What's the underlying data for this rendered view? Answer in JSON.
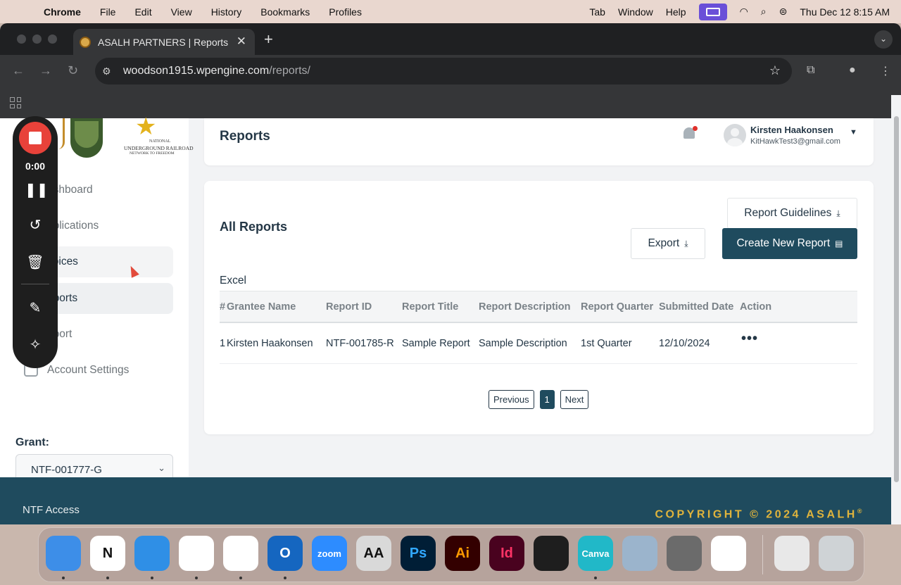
{
  "menubar": {
    "app": "Chrome",
    "items": [
      "File",
      "Edit",
      "View",
      "History",
      "Bookmarks",
      "Profiles"
    ],
    "right_items": [
      "Tab",
      "Window",
      "Help"
    ],
    "datetime": "Thu Dec 12  8:15 AM"
  },
  "browser": {
    "tab_title": "ASALH PARTNERS | Reports",
    "url_host": "woodson1915.wpengine.com",
    "url_path": "/reports/"
  },
  "sidebar": {
    "logos": {
      "nps": "NATIONAL PARK SERVICE",
      "ugrr_1": "NATIONAL",
      "ugrr_2": "UNDERGROUND RAILROAD",
      "ugrr_3": "NETWORK TO FREEDOM"
    },
    "items": [
      {
        "label": "Dashboard",
        "visible": "ashboard"
      },
      {
        "label": "Applications",
        "visible": "pplications"
      },
      {
        "label": "Invoices",
        "visible": "voices"
      },
      {
        "label": "Reports",
        "visible": "eports"
      },
      {
        "label": "Support",
        "visible": "pport"
      },
      {
        "label": "Account Settings",
        "visible": "Account Settings"
      }
    ],
    "grant_label": "Grant:",
    "grant_value": "NTF-001777-G"
  },
  "header": {
    "title": "Reports",
    "user_name": "Kirsten Haakonsen",
    "user_email": "KitHawkTest3@gmail.com"
  },
  "reports": {
    "title": "All Reports",
    "guidelines_label": "Report Guidelines",
    "export_label": "Export",
    "create_label": "Create New Report",
    "excel_label": "Excel",
    "columns": [
      "#",
      "Grantee Name",
      "Report ID",
      "Report Title",
      "Report Description",
      "Report Quarter",
      "Submitted Date",
      "Action"
    ],
    "rows": [
      [
        "1",
        "Kirsten Haakonsen",
        "NTF-001785-R",
        "Sample Report",
        "Sample Description",
        "1st Quarter",
        "12/10/2024",
        "•••"
      ]
    ],
    "pager": {
      "previous": "Previous",
      "current": "1",
      "next": "Next"
    }
  },
  "footer": {
    "link": "NTF Access",
    "copyright": "COPYRIGHT © 2024 ASALH",
    "reg": "®"
  },
  "recorder": {
    "time": "0:00"
  },
  "dock": {
    "apps": [
      {
        "name": "Finder",
        "color": "#3d8ee8",
        "glyph": ""
      },
      {
        "name": "Notion",
        "color": "#ffffff",
        "glyph": "N"
      },
      {
        "name": "Safari",
        "color": "#2f8fe6",
        "glyph": ""
      },
      {
        "name": "Chrome",
        "color": "#ffffff",
        "glyph": ""
      },
      {
        "name": "Slack",
        "color": "#ffffff",
        "glyph": ""
      },
      {
        "name": "Outlook",
        "color": "#1566c0",
        "glyph": "O"
      },
      {
        "name": "Zoom",
        "color": "#2d8cff",
        "glyph": "zoom"
      },
      {
        "name": "Font Book",
        "color": "#d9d9d9",
        "glyph": "AA"
      },
      {
        "name": "Photoshop",
        "color": "#001e36",
        "glyph": "Ps"
      },
      {
        "name": "Illustrator",
        "color": "#330000",
        "glyph": "Ai"
      },
      {
        "name": "InDesign",
        "color": "#49021f",
        "glyph": "Id"
      },
      {
        "name": "Figma",
        "color": "#1e1e1e",
        "glyph": ""
      },
      {
        "name": "Canva",
        "color": "#21b8c8",
        "glyph": "Canva"
      },
      {
        "name": "Preview",
        "color": "#9bb4cc",
        "glyph": ""
      },
      {
        "name": "Calculator",
        "color": "#6b6b6b",
        "glyph": ""
      },
      {
        "name": "Perplexity",
        "color": "#ffffff",
        "glyph": ""
      },
      {
        "name": "Screenshot",
        "color": "#e8e8e8",
        "glyph": ""
      },
      {
        "name": "Trash",
        "color": "#cfd3d6",
        "glyph": ""
      }
    ]
  }
}
